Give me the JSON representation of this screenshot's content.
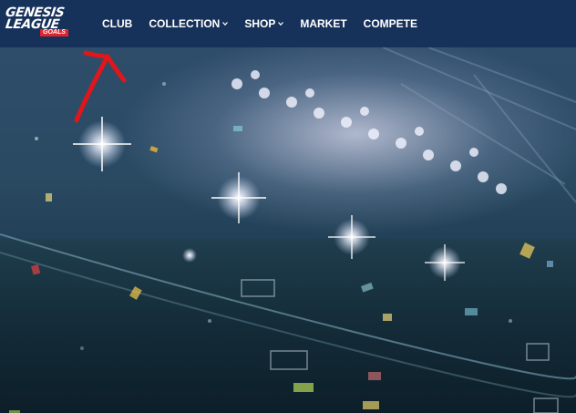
{
  "brand": {
    "line1": "GENESIS",
    "line2": "LEAGUE",
    "badge": "GOALS"
  },
  "nav": {
    "items": [
      {
        "label": "CLUB",
        "has_dropdown": false
      },
      {
        "label": "COLLECTION",
        "has_dropdown": true
      },
      {
        "label": "SHOP",
        "has_dropdown": true
      },
      {
        "label": "MARKET",
        "has_dropdown": false
      },
      {
        "label": "COMPETE",
        "has_dropdown": false
      }
    ]
  },
  "colors": {
    "navbar": "#17325a",
    "accent": "#e0242e",
    "annotation": "#e0161b"
  },
  "icons": {
    "dropdown": "chevron-down-icon",
    "annotation": "arrow-up-icon"
  }
}
